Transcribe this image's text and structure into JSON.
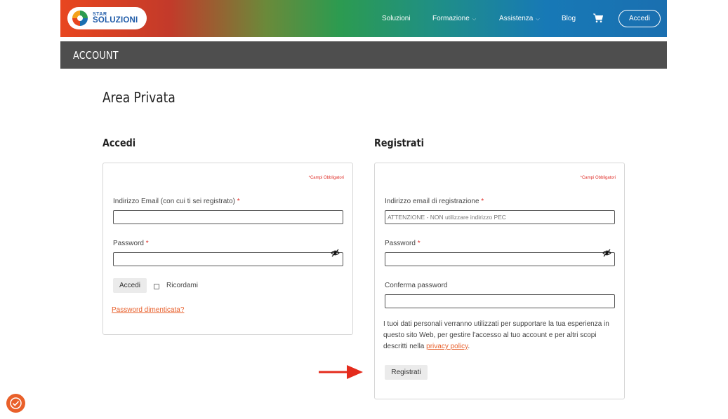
{
  "brand": {
    "line1": "STAR",
    "line2": "SOLUZIONI",
    "color": "#1f5ba8"
  },
  "nav": {
    "items": [
      {
        "label": "Soluzioni",
        "dropdown": false
      },
      {
        "label": "Formazione",
        "dropdown": true
      },
      {
        "label": "Assistenza",
        "dropdown": true
      },
      {
        "label": "Blog",
        "dropdown": false
      }
    ],
    "cart_icon": "cart-icon",
    "login_label": "Accedi"
  },
  "account_bar": {
    "title": "ACCOUNT"
  },
  "page": {
    "title": "Area Privata"
  },
  "login": {
    "title": "Accedi",
    "required_note": "*Campi Obbligatori",
    "email_label": "Indirizzo Email (con cui ti sei registrato)",
    "email_value": "",
    "password_label": "Password",
    "password_value": "",
    "submit_label": "Accedi",
    "remember_label": "Ricordami",
    "remember_checked": false,
    "forgot_label": "Password dimenticata?"
  },
  "register": {
    "title": "Registrati",
    "required_note": "*Campi Obbligatori",
    "email_label": "Indirizzo email di registrazione",
    "email_placeholder": "ATTENZIONE - NON utilizzare indirizzo PEC",
    "password_label": "Password",
    "confirm_label": "Conferma password",
    "privacy_text": "I tuoi dati personali verranno utilizzati per supportare la tua esperienza in questo sito Web, per gestire l'accesso al tuo account e per altri scopi descritti nella ",
    "privacy_link": "privacy policy",
    "privacy_end": ".",
    "submit_label": "Registrati"
  },
  "colors": {
    "accent": "#e8602c",
    "required": "#e0312b",
    "bar": "#4e4e4e",
    "arrow": "#e42b1c"
  }
}
